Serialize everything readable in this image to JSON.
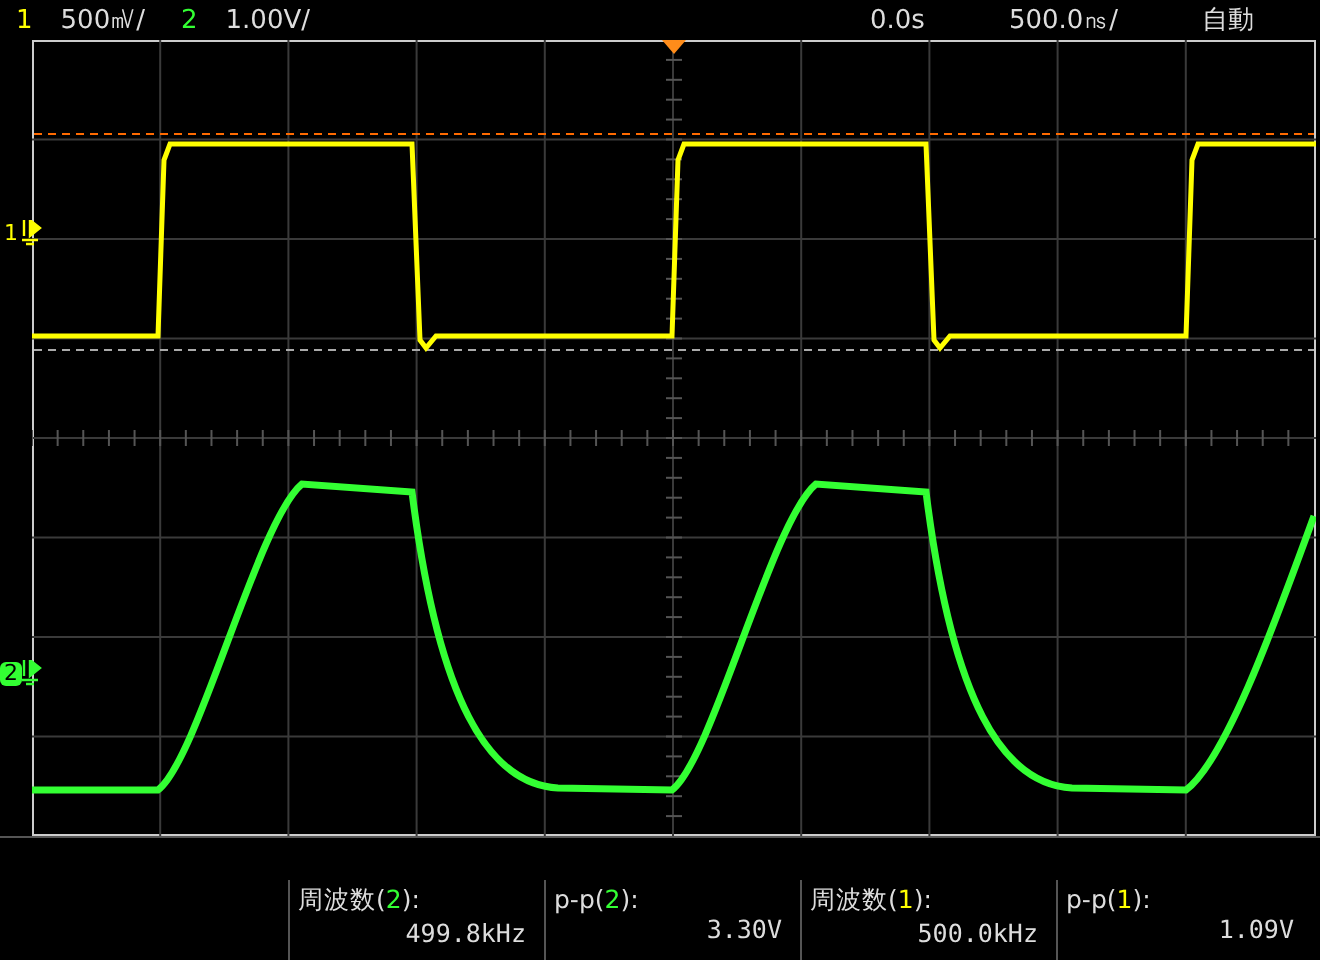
{
  "channels": [
    {
      "number": "1",
      "scale": "500㎷/",
      "color": "#ffff00"
    },
    {
      "number": "2",
      "scale": "1.00V/",
      "color": "#33ff33"
    }
  ],
  "timebase": {
    "delay": "0.0s",
    "scale": "500.0㎱/"
  },
  "trigger_mode": "自動",
  "markers": [
    {
      "label": "1",
      "color": "#ffff00"
    },
    {
      "label": "2",
      "color": "#33ff33"
    }
  ],
  "measurements": [
    {
      "label": "周波数(",
      "channel": "2",
      "label_end": "):",
      "value": "499.8kHz",
      "color": "#33ff33"
    },
    {
      "label": "p-p(",
      "channel": "2",
      "label_end": "):",
      "value": "3.30V",
      "color": "#33ff33"
    },
    {
      "label": "周波数(",
      "channel": "1",
      "label_end": "):",
      "value": "500.0kHz",
      "color": "#ffff00"
    },
    {
      "label": "p-p(",
      "channel": "1",
      "label_end": "):",
      "value": "1.09V",
      "color": "#ffff00"
    }
  ]
}
